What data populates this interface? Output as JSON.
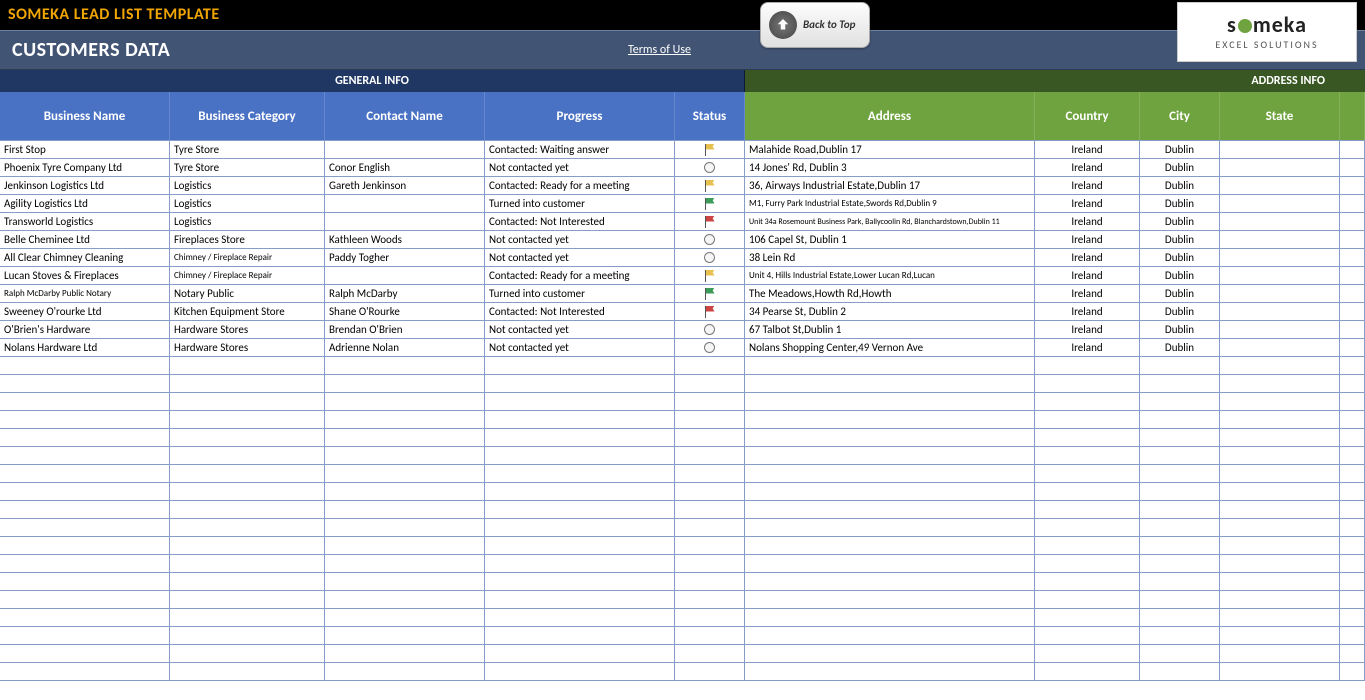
{
  "app": {
    "title": "SOMEKA LEAD LIST TEMPLATE"
  },
  "header": {
    "customers_label": "CUSTOMERS DATA",
    "terms_label": "Terms of Use",
    "back_to_top": "Back to Top",
    "logo_main": "someka",
    "logo_sub": "EXCEL SOLUTIONS"
  },
  "sections": {
    "general": "GENERAL INFO",
    "address": "ADDRESS INFO"
  },
  "columns": {
    "business_name": "Business Name",
    "business_category": "Business Category",
    "contact_name": "Contact Name",
    "progress": "Progress",
    "status": "Status",
    "address": "Address",
    "country": "Country",
    "city": "City",
    "state": "State"
  },
  "rows": [
    {
      "name": "First Stop",
      "cat": "Tyre Store",
      "contact": "",
      "progress": "Contacted: Waiting answer",
      "status": "flag-yellow",
      "address": "Malahide Road,Dublin 17",
      "country": "Ireland",
      "city": "Dublin",
      "state": ""
    },
    {
      "name": "Phoenix Tyre Company Ltd",
      "cat": "Tyre Store",
      "contact": "Conor English",
      "progress": "Not contacted yet",
      "status": "circle",
      "address": "14 Jones' Rd, Dublin 3",
      "country": "Ireland",
      "city": "Dublin",
      "state": ""
    },
    {
      "name": "Jenkinson Logistics Ltd",
      "cat": "Logistics",
      "contact": "Gareth Jenkinson",
      "progress": "Contacted: Ready for a meeting",
      "status": "flag-yellow",
      "address": "36, Airways Industrial Estate,Dublin 17",
      "country": "Ireland",
      "city": "Dublin",
      "state": ""
    },
    {
      "name": "Agility Logistics Ltd",
      "cat": "Logistics",
      "contact": "",
      "progress": "Turned into customer",
      "status": "flag-green",
      "address": "M1, Furry Park Industrial Estate,Swords Rd,Dublin 9",
      "country": "Ireland",
      "city": "Dublin",
      "state": "",
      "addr_small": true
    },
    {
      "name": "Transworld Logistics",
      "cat": "Logistics",
      "contact": "",
      "progress": "Contacted: Not Interested",
      "status": "flag-red",
      "address": "Unit 34a Rosemount Business Park, Ballycoolin Rd, Blanchardstown,Dublin 11",
      "country": "Ireland",
      "city": "Dublin",
      "state": "",
      "addr_tiny": true
    },
    {
      "name": "Belle Cheminee Ltd",
      "cat": "Fireplaces Store",
      "contact": "Kathleen Woods",
      "progress": "Not contacted yet",
      "status": "circle",
      "address": "106 Capel St, Dublin 1",
      "country": "Ireland",
      "city": "Dublin",
      "state": ""
    },
    {
      "name": "All Clear Chimney Cleaning",
      "cat": "Chimney / Fireplace Repair",
      "contact": "Paddy Togher",
      "progress": "Not contacted yet",
      "status": "circle",
      "address": "38 Lein Rd",
      "country": "Ireland",
      "city": "Dublin",
      "state": "",
      "cat_small": true
    },
    {
      "name": "Lucan Stoves & Fireplaces",
      "cat": "Chimney / Fireplace Repair",
      "contact": "",
      "progress": "Contacted: Ready for a meeting",
      "status": "flag-yellow",
      "address": "Unit 4, Hills Industrial Estate,Lower Lucan Rd,Lucan",
      "country": "Ireland",
      "city": "Dublin",
      "state": "",
      "cat_small": true,
      "addr_small": true
    },
    {
      "name": "Ralph McDarby Public Notary",
      "cat": "Notary Public",
      "contact": "Ralph McDarby",
      "progress": "Turned into customer",
      "status": "flag-green",
      "address": "The Meadows,Howth Rd,Howth",
      "country": "Ireland",
      "city": "Dublin",
      "state": "",
      "name_small": true
    },
    {
      "name": "Sweeney O'rourke Ltd",
      "cat": "Kitchen Equipment Store",
      "contact": "Shane O'Rourke",
      "progress": "Contacted: Not Interested",
      "status": "flag-red",
      "address": "34 Pearse St, Dublin 2",
      "country": "Ireland",
      "city": "Dublin",
      "state": ""
    },
    {
      "name": "O'Brien's Hardware",
      "cat": "Hardware Stores",
      "contact": "Brendan O'Brien",
      "progress": "Not contacted yet",
      "status": "circle",
      "address": "67 Talbot St,Dublin 1",
      "country": "Ireland",
      "city": "Dublin",
      "state": ""
    },
    {
      "name": "Nolans Hardware Ltd",
      "cat": "Hardware Stores",
      "contact": "Adrienne Nolan",
      "progress": "Not contacted yet",
      "status": "circle",
      "address": "Nolans Shopping Center,49 Vernon Ave",
      "country": "Ireland",
      "city": "Dublin",
      "state": ""
    }
  ],
  "empty_rows": 18
}
